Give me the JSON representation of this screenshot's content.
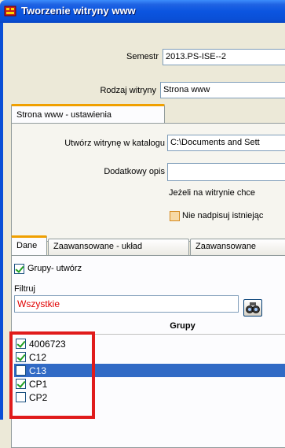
{
  "window": {
    "title": "Tworzenie witryny www"
  },
  "form": {
    "semestr_label": "Semestr",
    "semestr_value": "2013.PS-ISE--2",
    "rodzaj_label": "Rodzaj witryny",
    "rodzaj_value": "Strona www"
  },
  "settings_tab": {
    "label": "Strona www - ustawienia"
  },
  "settings": {
    "katalog_label": "Utwórz witrynę w katalogu",
    "katalog_value": "C:\\Documents and Sett",
    "opis_label": "Dodatkowy opis",
    "opis_value": "",
    "note_text": "Jeżeli na witrynie chce",
    "overwrite_label": "Nie nadpisuj istniejąc",
    "overwrite_checked": false
  },
  "bottom_tabs": [
    {
      "label": "Dane"
    },
    {
      "label": "Zaawansowane - układ"
    },
    {
      "label": "Zaawansowane"
    }
  ],
  "dane": {
    "grupy_create_label": "Grupy- utwórz",
    "grupy_create_checked": true,
    "filtr_label": "Filtruj",
    "filtr_value": "Wszystkie",
    "grid_header": "Grupy",
    "rows": [
      {
        "label": "4006723",
        "checked": true,
        "selected": false
      },
      {
        "label": "C12",
        "checked": true,
        "selected": false
      },
      {
        "label": "C13",
        "checked": false,
        "selected": true
      },
      {
        "label": "CP1",
        "checked": true,
        "selected": false
      },
      {
        "label": "CP2",
        "checked": false,
        "selected": false
      }
    ]
  },
  "colors": {
    "title_bar": "#0a4fd6",
    "selection": "#316ac5",
    "filter_text": "#e00000",
    "highlight_box": "#e01b1b",
    "tab_accent": "#f0a000"
  },
  "icons": {
    "app": "app-window-icon",
    "filter": "binoculars-icon"
  }
}
